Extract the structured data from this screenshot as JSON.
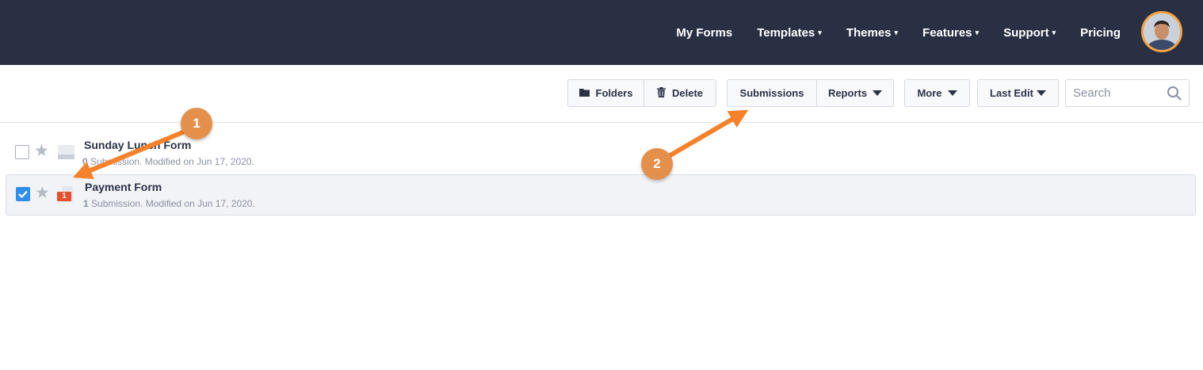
{
  "nav": {
    "items": [
      {
        "label": "My Forms",
        "dropdown": false
      },
      {
        "label": "Templates",
        "dropdown": true
      },
      {
        "label": "Themes",
        "dropdown": true
      },
      {
        "label": "Features",
        "dropdown": true
      },
      {
        "label": "Support",
        "dropdown": true
      },
      {
        "label": "Pricing",
        "dropdown": false
      }
    ],
    "dropdown_caret": "▾"
  },
  "toolbar": {
    "folders_label": "Folders",
    "delete_label": "Delete",
    "submissions_label": "Submissions",
    "reports_label": "Reports",
    "more_label": "More",
    "last_edit_label": "Last Edit",
    "search_placeholder": "Search"
  },
  "forms": [
    {
      "name": "Sunday Lunch Form",
      "count": "0",
      "meta": " Submission. Modified on Jun 17, 2020.",
      "checked": false,
      "new_badge": ""
    },
    {
      "name": "Payment Form",
      "count": "1",
      "meta": " Submission. Modified on Jun 17, 2020.",
      "checked": true,
      "new_badge": "1"
    }
  ],
  "annotations": {
    "badge_1": "1",
    "badge_2": "2",
    "color": "#f5822a"
  },
  "colors": {
    "nav_bg": "#293044",
    "accent_check": "#2f8ee9",
    "badge_red": "#e8502d"
  },
  "icons": [
    "folder-icon",
    "trash-icon",
    "search-icon",
    "star-icon",
    "form-icon",
    "checkbox-icon",
    "avatar"
  ]
}
